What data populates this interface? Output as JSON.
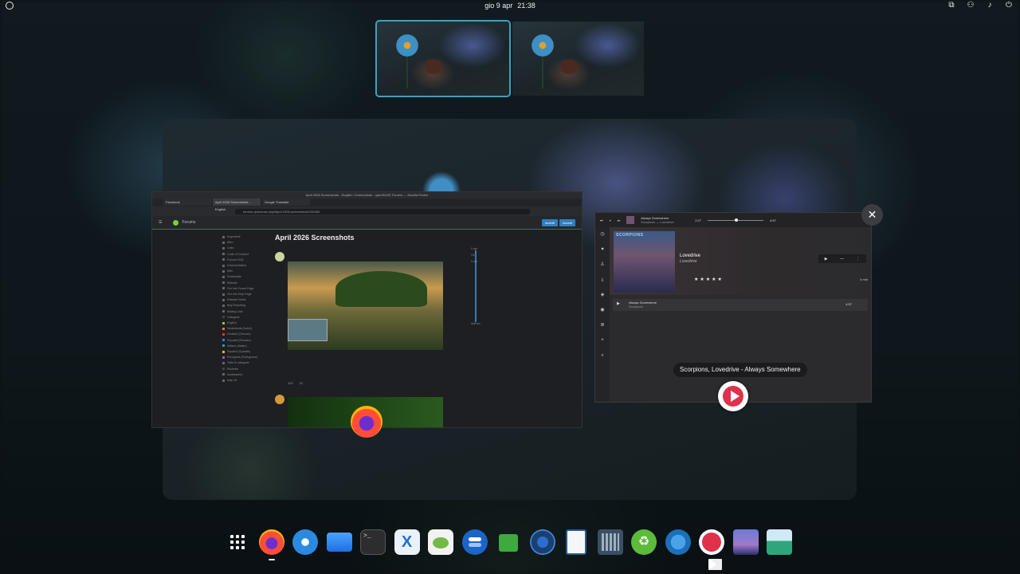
{
  "topbar": {
    "date": "gio 9 apr",
    "time": "21:38",
    "left_icon": "system-logo-icon",
    "tray_icons": [
      "screen-recording-icon",
      "network-icon",
      "volume-icon",
      "power-icon"
    ]
  },
  "workspaces": [
    {
      "name": "workspace-1",
      "active": true
    },
    {
      "name": "workspace-2",
      "active": false
    }
  ],
  "firefox_window": {
    "title": "April 2026 Screenshots - English / Screenshots - openSUSE Forums — Mozilla Firefox",
    "tabs": [
      "Facebook",
      "April 2026 Screenshots - English",
      "Google Translate"
    ],
    "url": "forums.opensuse.org/t/april-2026-screenshots/190486",
    "site_name": "Forums",
    "buttons": [
      "Iscriviti",
      "Accedi"
    ],
    "page_heading": "April 2026 Screenshots",
    "sidebar_items": [
      "Argomenti",
      "Altro",
      "Links",
      "Code of Conduct",
      "Forums FAQ",
      "Documentation",
      "Wiki",
      "Downloads",
      "Website",
      "Get Into Forum Page",
      "Get Into Help Page",
      "Release Notes",
      "Bug Reporting",
      "Mailing Lists",
      "Categorie",
      "English",
      "Nederlands (Dutch)",
      "Deutsch (German)",
      "Русский (Russian)",
      "Italiano (Italian)",
      "Español (Spanish)",
      "Português (Portuguese)",
      "Tutte le categorie",
      "Etichette",
      "tumbleweed",
      "leap-16"
    ],
    "post_meta": [
      "122",
      "21"
    ],
    "timeline": [
      "9 apr",
      "1/2",
      "9 apr",
      "Adesso"
    ]
  },
  "music_window": {
    "now_playing": "Always Somewhere",
    "now_playing_sub": "Scorpions — Lovedrive",
    "elapsed": "2:27",
    "duration": "4:57",
    "album_title": "Lovedrive",
    "album_artist": "Lovedrive",
    "cover_band": "SCORPIONS",
    "album_length": "4 min",
    "rating_stars": "★★★★★",
    "track_title": "Always Somewhere",
    "track_artist": "Scorpions",
    "track_length": "4:57"
  },
  "window_label": "Scorpions, Lovedrive - Always Somewhere",
  "close_label": "✕",
  "dash_apps": [
    {
      "name": "show-apps-grid-icon",
      "running": false
    },
    {
      "name": "firefox-icon",
      "running": true
    },
    {
      "name": "thunderbird-icon",
      "running": false
    },
    {
      "name": "files-icon",
      "running": false
    },
    {
      "name": "terminal-icon",
      "running": false,
      "glyph": ">_"
    },
    {
      "name": "xdg-app-icon",
      "running": false,
      "glyph": "X"
    },
    {
      "name": "yast-gecko-icon",
      "running": false
    },
    {
      "name": "tweaks-toggle-icon",
      "running": false
    },
    {
      "name": "extensions-puzzle-icon",
      "running": false
    },
    {
      "name": "settings-icon",
      "running": false
    },
    {
      "name": "text-editor-icon",
      "running": false
    },
    {
      "name": "calculator-icon",
      "running": false
    },
    {
      "name": "recycle-icon",
      "running": false,
      "glyph": "♻"
    },
    {
      "name": "compass-browser-icon",
      "running": false
    },
    {
      "name": "music-player-icon",
      "running": true
    },
    {
      "name": "wallpaper-icon",
      "running": false
    },
    {
      "name": "image-viewer-icon",
      "running": false
    }
  ]
}
